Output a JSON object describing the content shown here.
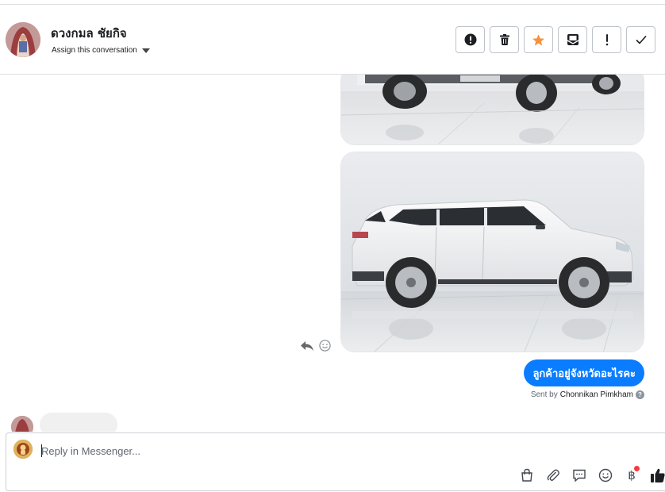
{
  "header": {
    "contact_name": "ดวงกมล ชัยกิจ",
    "assign_label": "Assign this conversation",
    "actions": [
      {
        "name": "mark-spam-button",
        "icon": "exclamation-circle-icon"
      },
      {
        "name": "delete-button",
        "icon": "trash-icon"
      },
      {
        "name": "star-button",
        "icon": "star-icon",
        "color": "#f7923b"
      },
      {
        "name": "mark-unread-button",
        "icon": "envelope-icon"
      },
      {
        "name": "follow-up-button",
        "icon": "exclamation-icon"
      },
      {
        "name": "mark-done-button",
        "icon": "checkmark-icon"
      }
    ]
  },
  "conversation": {
    "outgoing_message": "ลูกค้าอยู่จังหวัดอะไรคะ",
    "sent_by_prefix": "Sent by",
    "sent_by_name": "Chonnikan Pimkham",
    "bubble_color": "#0a7cff"
  },
  "composer": {
    "placeholder": "Reply in Messenger...",
    "tools": [
      "shopping-bag-icon",
      "paperclip-icon",
      "saved-replies-icon",
      "emoji-icon",
      "baht-payment-icon",
      "thumbs-up-icon"
    ],
    "baht_symbol": "฿"
  }
}
